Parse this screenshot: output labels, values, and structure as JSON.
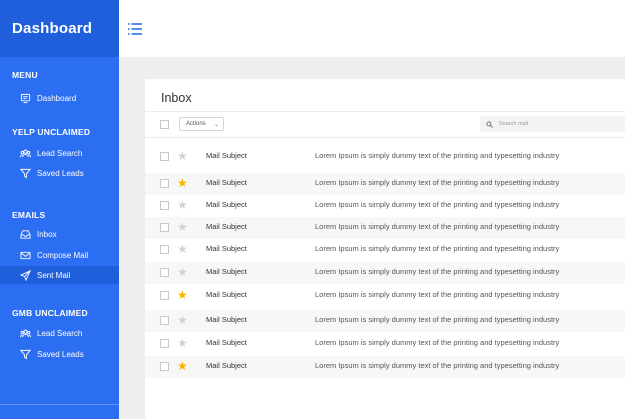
{
  "sidebar": {
    "brand": "Dashboard",
    "sections": [
      {
        "title": "MENU",
        "items": [
          {
            "label": "Dashboard",
            "icon": "dashboard-icon"
          }
        ]
      },
      {
        "title": "YELP UNCLAIMED",
        "items": [
          {
            "label": "Lead Search",
            "icon": "people-icon"
          },
          {
            "label": "Saved Leads",
            "icon": "filter-icon"
          }
        ]
      },
      {
        "title": "EMAILS",
        "items": [
          {
            "label": "Inbox",
            "icon": "inbox-icon"
          },
          {
            "label": "Compose Mail",
            "icon": "mail-icon"
          },
          {
            "label": "Sent Mail",
            "icon": "send-icon",
            "active": true
          }
        ]
      },
      {
        "title": "GMB UNCLAIMED",
        "items": [
          {
            "label": "Lead Search",
            "icon": "people-icon"
          },
          {
            "label": "Saved Leads",
            "icon": "filter-icon"
          }
        ]
      }
    ]
  },
  "topbar": {
    "menu_icon": "hamburger-icon"
  },
  "inbox": {
    "title": "Inbox",
    "actions_label": "Actions",
    "search_placeholder": "Search mail",
    "rows": [
      {
        "starred": false,
        "subject": "Mail Subject",
        "preview": "Lorem Ipsum is simply dummy text of the printing and typesetting industry"
      },
      {
        "starred": true,
        "subject": "Mail Subject",
        "preview": "Lorem Ipsum is simply dummy text of the printing and typesetting industry"
      },
      {
        "starred": false,
        "subject": "Mail Subject",
        "preview": "Lorem Ipsum is simply dummy text of the printing and typesetting industry"
      },
      {
        "starred": false,
        "subject": "Mail Subject",
        "preview": "Lorem Ipsum is simply dummy text of the printing and typesetting industry"
      },
      {
        "starred": false,
        "subject": "Mail Subject",
        "preview": "Lorem Ipsum is simply dummy text of the printing and typesetting industry"
      },
      {
        "starred": false,
        "subject": "Mail Subject",
        "preview": "Lorem Ipsum is simply dummy text of the printing and typesetting industry"
      },
      {
        "starred": true,
        "subject": "Mail Subject",
        "preview": "Lorem Ipsum is simply dummy text of the printing and typesetting industry"
      },
      {
        "starred": false,
        "subject": "Mail Subject",
        "preview": "Lorem Ipsum is simply dummy text of the printing and typesetting industry"
      },
      {
        "starred": false,
        "subject": "Mail Subject",
        "preview": "Lorem Ipsum is simply dummy text of the printing and typesetting industry"
      },
      {
        "starred": true,
        "subject": "Mail Subject",
        "preview": "Lorem Ipsum is simply dummy text of the printing and typesetting industry"
      }
    ]
  },
  "colors": {
    "sidebar": "#2c6ef2",
    "sidebar_dark": "#1f5fdc",
    "star": "#f5b400",
    "accent": "#2c6ef2"
  }
}
